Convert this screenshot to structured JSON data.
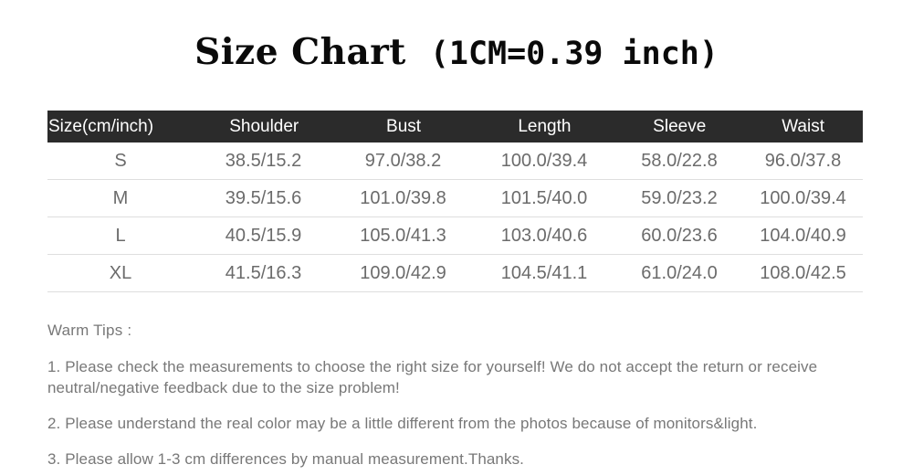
{
  "title": {
    "main": "Size Chart",
    "conversion": "(1CM=0.39 inch)"
  },
  "colors": {
    "header_background": "#2b2b2b",
    "header_text": "#ffffff",
    "cell_text": "#6b6b6b",
    "tips_text": "#787878",
    "row_divider": "#dedede",
    "page_background": "#ffffff"
  },
  "table": {
    "columns": [
      "Size(cm/inch)",
      "Shoulder",
      "Bust",
      "Length",
      "Sleeve",
      "Waist"
    ],
    "rows": [
      {
        "size": "S",
        "shoulder": "38.5/15.2",
        "bust": "97.0/38.2",
        "length": "100.0/39.4",
        "sleeve": "58.0/22.8",
        "waist": "96.0/37.8"
      },
      {
        "size": "M",
        "shoulder": "39.5/15.6",
        "bust": "101.0/39.8",
        "length": "101.5/40.0",
        "sleeve": "59.0/23.2",
        "waist": "100.0/39.4"
      },
      {
        "size": "L",
        "shoulder": "40.5/15.9",
        "bust": "105.0/41.3",
        "length": "103.0/40.6",
        "sleeve": "60.0/23.6",
        "waist": "104.0/40.9"
      },
      {
        "size": "XL",
        "shoulder": "41.5/16.3",
        "bust": "109.0/42.9",
        "length": "104.5/41.1",
        "sleeve": "61.0/24.0",
        "waist": "108.0/42.5"
      }
    ]
  },
  "tips": {
    "heading": "Warm Tips :",
    "items": [
      "1. Please check the measurements to choose the right size for yourself! We do not accept the return or receive neutral/negative feedback due to the size problem!",
      "2. Please understand the real color may be a little different from the photos because of monitors&light.",
      "3. Please allow 1-3 cm differences by manual measurement.Thanks."
    ]
  }
}
